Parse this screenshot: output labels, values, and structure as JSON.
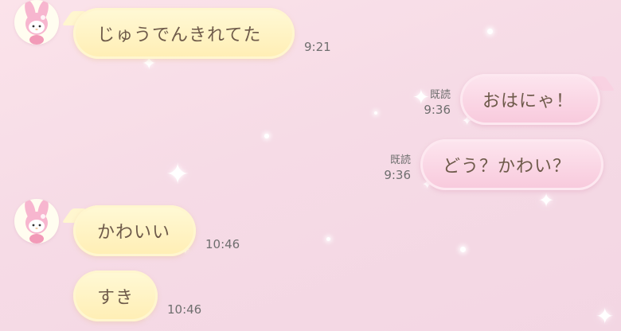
{
  "messages": {
    "m1": {
      "text": "じゅうでんきれてた",
      "time": "9:21"
    },
    "m2": {
      "text": "おはにゃ！",
      "read": "既読",
      "time": "9:36"
    },
    "m3": {
      "text": "どう？かわい？",
      "read": "既読",
      "time": "9:36"
    },
    "m4": {
      "text": "かわいい",
      "time": "10:46"
    },
    "m5": {
      "text": "すき",
      "time": "10:46"
    }
  },
  "colors": {
    "incoming_bubble": "#ffeeb4",
    "outgoing_bubble": "#f8c9dc",
    "background": "#f6dbe6",
    "text": "#6e5a4a"
  },
  "icons": {
    "avatar": "my-melody-avatar-icon",
    "sparkle": "four-point-star-sparkle-icon"
  }
}
